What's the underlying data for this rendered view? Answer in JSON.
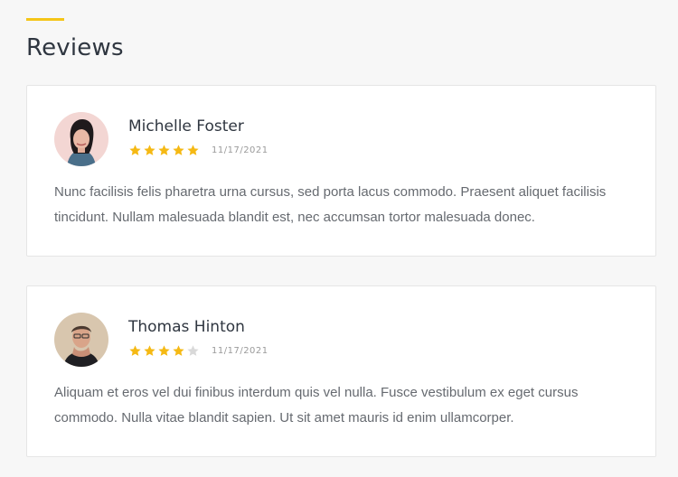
{
  "section": {
    "title": "Reviews",
    "accent_color": "#f5c518"
  },
  "reviews": [
    {
      "name": "Michelle Foster",
      "rating": 5,
      "max_rating": 5,
      "date": "11/17/2021",
      "text": "Nunc facilisis felis pharetra urna cursus, sed porta lacus commodo. Praesent aliquet facilisis tincidunt. Nullam malesuada blandit est, nec accumsan tortor malesuada donec.",
      "avatar": "avatar-woman"
    },
    {
      "name": "Thomas Hinton",
      "rating": 4,
      "max_rating": 5,
      "date": "11/17/2021",
      "text": "Aliquam et eros vel dui finibus interdum quis vel nulla. Fusce vestibulum ex eget cursus commodo. Nulla vitae blandit sapien. Ut sit amet mauris id enim ullamcorper.",
      "avatar": "avatar-man"
    }
  ],
  "colors": {
    "star_filled": "#f5b914",
    "star_empty": "#d9d9d9"
  },
  "icons": {
    "star": "star-icon"
  }
}
